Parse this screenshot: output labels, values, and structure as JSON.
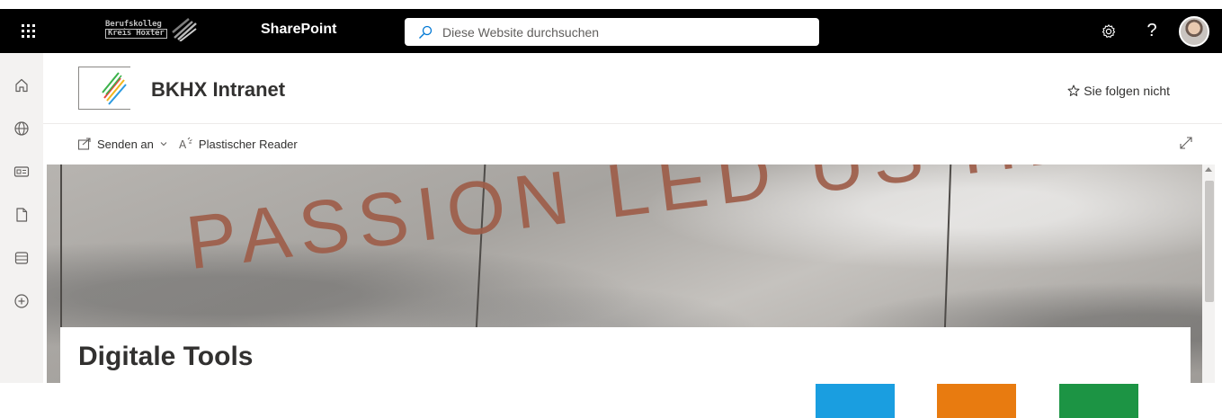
{
  "suitebar": {
    "org_logo_line1": "Berufskolleg",
    "org_logo_line2": "Kreis Höxter",
    "app_name": "SharePoint",
    "search_placeholder": "Diese Website durchsuchen",
    "settings_icon": "gear-icon",
    "help_label": "?",
    "help_icon": "help-icon"
  },
  "appbar": {
    "items": [
      {
        "name": "home",
        "icon": "home-icon"
      },
      {
        "name": "sites",
        "icon": "globe-icon"
      },
      {
        "name": "news",
        "icon": "news-icon"
      },
      {
        "name": "files",
        "icon": "file-icon"
      },
      {
        "name": "lists",
        "icon": "list-icon"
      },
      {
        "name": "create",
        "icon": "plus-circle-icon"
      }
    ]
  },
  "site": {
    "title": "BKHX Intranet",
    "follow_label": "Sie folgen nicht"
  },
  "commandbar": {
    "send_label": "Senden an",
    "reader_label": "Plastischer Reader"
  },
  "hero": {
    "text": "PASSION LED US HERE"
  },
  "page": {
    "title": "Digitale Tools"
  },
  "tiles": [
    {
      "color": "#1a9ee0"
    },
    {
      "color": "#e87b10"
    },
    {
      "color": "#1c9444"
    }
  ],
  "colors": {
    "suitebar_bg": "#000000",
    "appbar_bg": "#f3f2f1",
    "text": "#323130",
    "logo_stripes": [
      "#e8473b",
      "#f2b61c",
      "#3bb24b",
      "#2d9be0"
    ]
  }
}
